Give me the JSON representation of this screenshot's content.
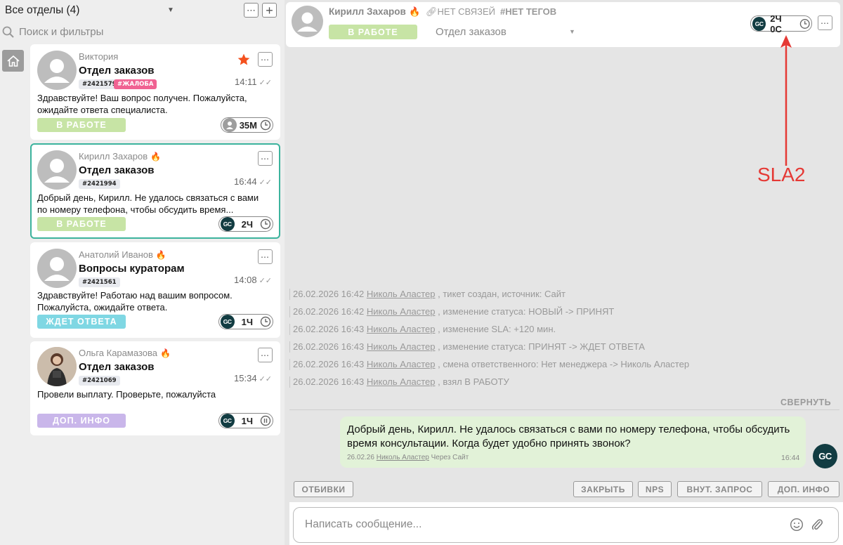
{
  "sidebar": {
    "department_title": "Все отделы (4)",
    "search_placeholder": "Поиск и фильтры"
  },
  "tickets": [
    {
      "name": "Виктория",
      "department": "Отдел заказов",
      "id": "#2421579",
      "extra_tag": "#ЖАЛОБА",
      "time": "14:11",
      "message": "Здравствуйте! Ваш вопрос получен. Пожалуйста, ожидайте ответа специалиста.",
      "status": "В РАБОТЕ",
      "sla": "35М",
      "starred": true
    },
    {
      "name": "Кирилл Захаров",
      "department": "Отдел заказов",
      "id": "#2421994",
      "time": "16:44",
      "message": "Добрый день, Кирилл. Не удалось связаться с вами по номеру телефона, чтобы обсудить время...",
      "status": "В РАБОТЕ",
      "sla": "2Ч",
      "selected": true
    },
    {
      "name": "Анатолий Иванов",
      "department": "Вопросы кураторам",
      "id": "#2421561",
      "time": "14:08",
      "message": "Здравствуйте! Работаю над вашим вопросом. Пожалуйста, ожидайте ответа.",
      "status": "ЖДЕТ ОТВЕТА",
      "sla": "1Ч"
    },
    {
      "name": "Ольга Карамазова",
      "department": "Отдел заказов",
      "id": "#2421069",
      "time": "15:34",
      "message": "Провели выплату. Проверьте, пожалуйста",
      "status": "ДОП. ИНФО",
      "sla": "1Ч"
    }
  ],
  "agent_initials": "GC",
  "header": {
    "name": "Кирилл Захаров",
    "links": "НЕТ СВЯЗЕЙ",
    "tags": "#НЕТ ТЕГОВ",
    "status": "В РАБОТЕ",
    "department": "Отдел заказов",
    "sla": "2Ч 0С"
  },
  "annotation": "SLA2",
  "log": [
    {
      "date": "26.02.2026 16:42",
      "user": "Николь Аластер",
      "text": ", тикет создан, источник: Сайт"
    },
    {
      "date": "26.02.2026 16:42",
      "user": "Николь Аластер",
      "text": ", изменение статуса: НОВЫЙ -> ПРИНЯТ"
    },
    {
      "date": "26.02.2026 16:43",
      "user": "Николь Аластер",
      "text": ", изменение SLA: +120 мин."
    },
    {
      "date": "26.02.2026 16:43",
      "user": "Николь Аластер",
      "text": ", изменение статуса: ПРИНЯТ -> ЖДЕТ ОТВЕТА"
    },
    {
      "date": "26.02.2026 16:43",
      "user": "Николь Аластер",
      "text": ", смена ответственного: Нет менеджера -> Николь Аластер"
    },
    {
      "date": "26.02.2026 16:43",
      "user": "Николь Аластер",
      "text": ", взял В РАБОТУ"
    }
  ],
  "collapse_label": "СВЕРНУТЬ",
  "message": {
    "text": "Добрый день, Кирилл. Не удалось связаться с вами по номеру телефона, чтобы обсудить время консультации. Когда будет удобно принять звонок?",
    "date": "26.02.26",
    "author": "Николь Аластер",
    "via": "Через Сайт",
    "time": "16:44"
  },
  "actions": {
    "replies": "ОТБИВКИ",
    "close": "ЗАКРЫТЬ",
    "nps": "NPS",
    "internal": "ВНУТ. ЗАПРОС",
    "more_info": "ДОП. ИНФО"
  },
  "composer": {
    "placeholder": "Написать сообщение..."
  },
  "colors": {
    "accent": "#3cb39d",
    "status_green": "#c7e4a5",
    "status_cyan": "#7fd7e3",
    "status_purple": "#c9b6ea",
    "tag_pink": "#f06292",
    "annotation": "#e53935",
    "bubble": "#e2f2d8"
  }
}
